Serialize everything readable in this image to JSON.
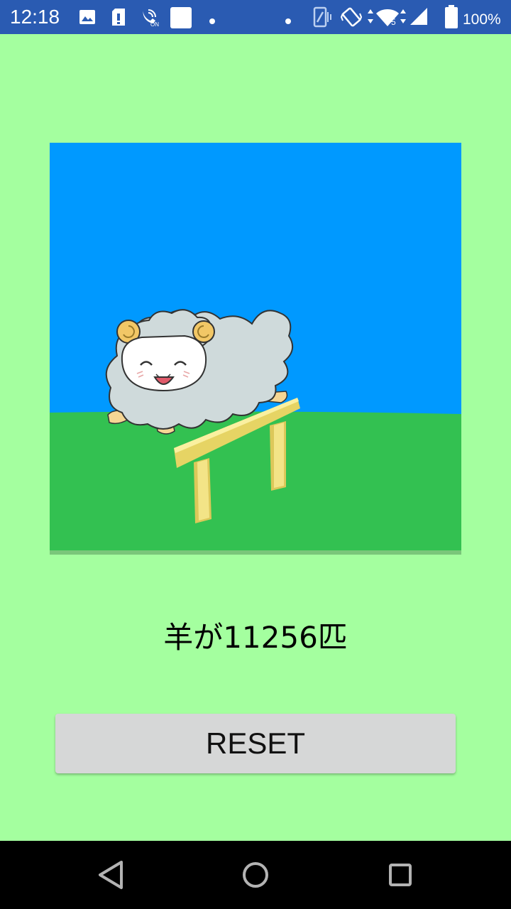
{
  "status_bar": {
    "time": "12:18",
    "battery_percent": "100%",
    "icons": [
      "image-icon",
      "sd-card-icon",
      "wifi-calling-icon",
      "blank-square-icon",
      "dot-icon",
      "dot-icon",
      "screen-icon",
      "vibrate-icon",
      "wifi-icon",
      "cell-signal-icon",
      "battery-icon"
    ],
    "background_color": "#2a5bb2"
  },
  "scene": {
    "sky_color": "#0099ff",
    "grass_color": "#33c151",
    "hurdle_color": "#f3e487",
    "sheep_icon": "sheep-icon"
  },
  "counter": {
    "text": "羊が11256匹",
    "count": 11256
  },
  "reset_button": {
    "label": "RESET",
    "color": "#d6d7d7"
  },
  "nav_bar": {
    "buttons": [
      "back-icon",
      "home-icon",
      "recents-icon"
    ]
  },
  "background_color": "#a4ff9f"
}
